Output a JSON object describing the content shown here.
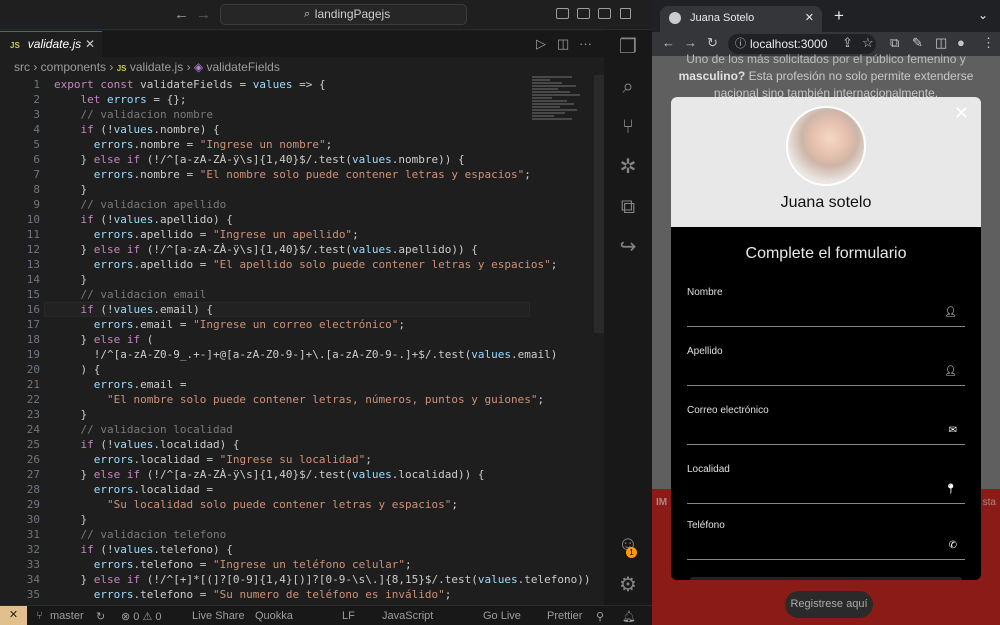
{
  "vscode": {
    "command_center": "landingPagejs",
    "tab": {
      "icon": "JS",
      "label": "validate.js"
    },
    "breadcrumb": {
      "p1": "src",
      "p2": "components",
      "icon": "JS",
      "p3": "validate.js",
      "p4": "validateFields"
    },
    "lines": [
      "export const validateFields = values => {",
      "    let errors = {};",
      "    // validacion nombre",
      "    if (!values.nombre) {",
      "      errors.nombre = \"Ingrese un nombre\";",
      "    } else if (!/^[a-zA-ZÀ-ÿ\\s]{1,40}$/.test(values.nombre)) {",
      "      errors.nombre = \"El nombre solo puede contener letras y espacios\";",
      "    }",
      "    // validacion apellido",
      "    if (!values.apellido) {",
      "      errors.apellido = \"Ingrese un apellido\";",
      "    } else if (!/^[a-zA-ZÀ-ÿ\\s]{1,40}$/.test(values.apellido)) {",
      "      errors.apellido = \"El apellido solo puede contener letras y espacios\";",
      "    }",
      "    // validacion email",
      "    if (!values.email) {",
      "      errors.email = \"Ingrese un correo electrónico\";",
      "    } else if (",
      "      !/^[a-zA-Z0-9_.+-]+@[a-zA-Z0-9-]+\\.[a-zA-Z0-9-.]+$/.test(values.email)",
      "    ) {",
      "      errors.email =",
      "        \"El nombre solo puede contener letras, números, puntos y guiones\";",
      "    }",
      "    // validacion localidad",
      "    if (!values.localidad) {",
      "      errors.localidad = \"Ingrese su localidad\";",
      "    } else if (!/^[a-zA-ZÀ-ÿ\\s]{1,40}$/.test(values.localidad)) {",
      "      errors.localidad =",
      "        \"Su localidad solo puede contener letras y espacios\";",
      "    }",
      "    // validacion telefono",
      "    if (!values.telefono) {",
      "      errors.telefono = \"Ingrese un teléfono celular\";",
      "    } else if (!/^[+]*[(]?[0-9]{1,4}[)]?[0-9-\\s\\.]{8,15}$/.test(values.telefono))",
      "      errors.telefono = \"Su numero de teléfono es inválido\";"
    ],
    "status": {
      "branch": "master",
      "problems": "⊗ 0 ⚠ 0",
      "live_share": "Live Share",
      "quokka": "Quokka",
      "eol": "LF",
      "language": "JavaScript",
      "go_live": "Go Live",
      "prettier": "Prettier"
    },
    "accounts_badge": "1"
  },
  "browser": {
    "tab_title": "Juana Sotelo",
    "url": "localhost:3000",
    "page_text_bold": "masculino?",
    "page_text": " Esta profesión no solo permite extenderse nacional sino también internacionalmente.",
    "page_text_top": "Uno de los más solicitados por el público femenino y",
    "side_left": "IM",
    "side_right": "sta",
    "register_button": "Registrese aquí",
    "modal": {
      "name": "Juana sotelo",
      "form_title": "Complete el formulario",
      "fields": [
        {
          "label": "Nombre",
          "icon": "person-icon"
        },
        {
          "label": "Apellido",
          "icon": "person-icon"
        },
        {
          "label": "Correo electrónico",
          "icon": "mail-icon"
        },
        {
          "label": "Localidad",
          "icon": "location-icon"
        },
        {
          "label": "Teléfono",
          "icon": "phone-icon"
        }
      ]
    }
  }
}
